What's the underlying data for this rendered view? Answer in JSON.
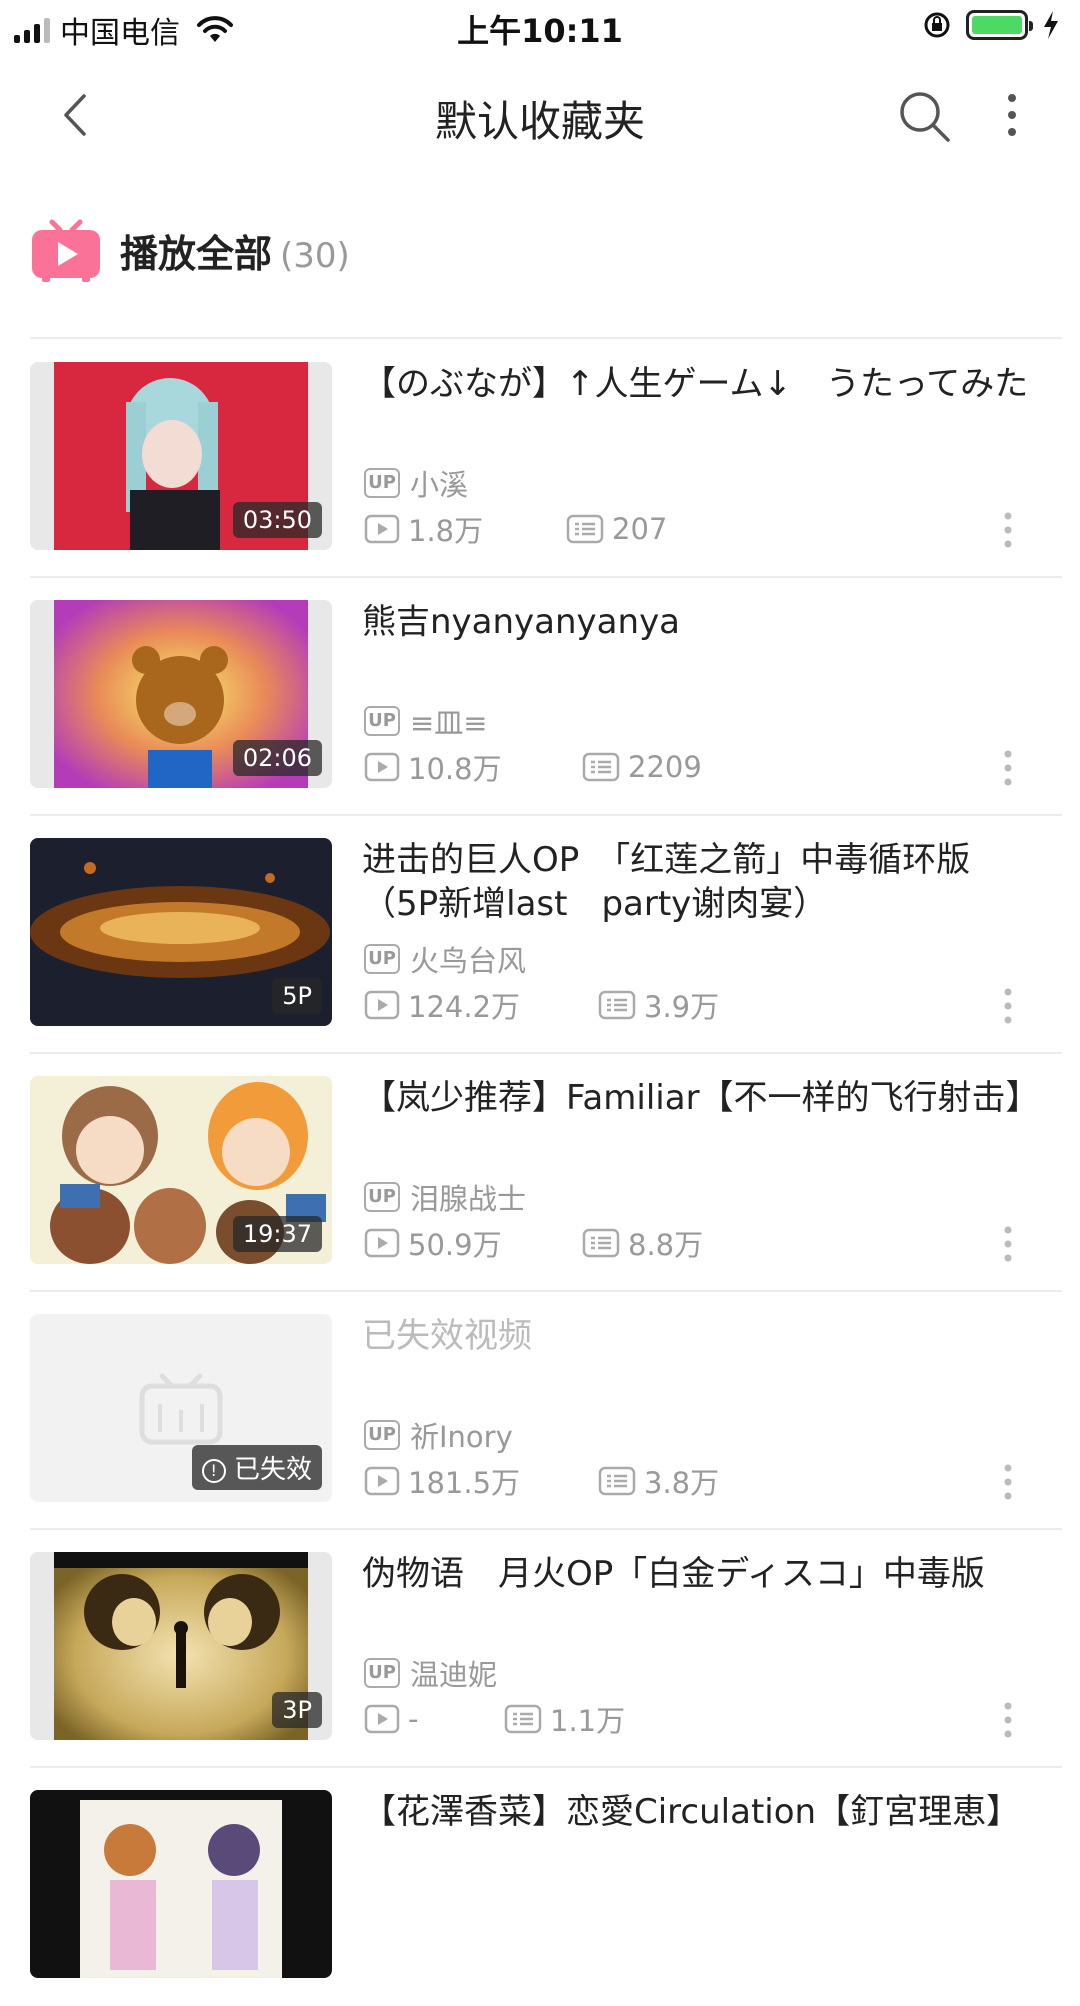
{
  "status_bar": {
    "carrier": "中国电信",
    "time": "上午10:11"
  },
  "nav": {
    "title": "默认收藏夹"
  },
  "play_all": {
    "label": "播放全部",
    "count": "(30)"
  },
  "colors": {
    "accent_pink": "#fb7299",
    "battery_green": "#4cd964"
  },
  "videos": [
    {
      "title": "【のぶなが】↑人生ゲーム↓　うたってみた",
      "up_badge": "UP",
      "uploader": "小溪",
      "plays": "1.8万",
      "danmaku": "207",
      "duration": "03:50"
    },
    {
      "title": "熊吉nyanyanyanya",
      "up_badge": "UP",
      "uploader": "≡皿≡",
      "plays": "10.8万",
      "danmaku": "2209",
      "duration": "02:06"
    },
    {
      "title": "进击的巨人OP　「红莲之箭」中毒循环版（5P新增last　party谢肉宴）",
      "up_badge": "UP",
      "uploader": "火鸟台风",
      "plays": "124.2万",
      "danmaku": "3.9万",
      "duration": "5P"
    },
    {
      "title": "【岚少推荐】Familiar【不一样的飞行射击】",
      "up_badge": "UP",
      "uploader": "泪腺战士",
      "plays": "50.9万",
      "danmaku": "8.8万",
      "duration": "19:37"
    },
    {
      "title": "已失效视频",
      "up_badge": "UP",
      "uploader": "祈Inory",
      "plays": "181.5万",
      "danmaku": "3.8万",
      "duration": "已失效"
    },
    {
      "title": "伪物语　月火OP「白金ディスコ」中毒版",
      "up_badge": "UP",
      "uploader": "温迪妮",
      "plays": "-",
      "danmaku": "1.1万",
      "duration": "3P"
    },
    {
      "title": "【花澤香菜】恋愛Circulation【釘宮理恵】"
    }
  ]
}
